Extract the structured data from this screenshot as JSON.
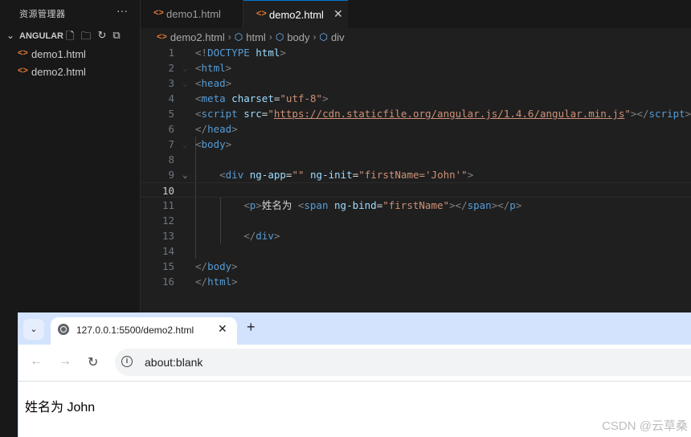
{
  "sidebar": {
    "title": "资源管理器",
    "more": "···",
    "folder": "ANGULAR",
    "files": [
      "demo1.html",
      "demo2.html"
    ]
  },
  "tabs": [
    {
      "label": "demo1.html"
    },
    {
      "label": "demo2.html"
    }
  ],
  "breadcrumb": [
    "demo2.html",
    "html",
    "body",
    "div"
  ],
  "editor": {
    "current_line": 10,
    "line_numbers": [
      "1",
      "2",
      "3",
      "4",
      "5",
      "6",
      "7",
      "8",
      "9",
      "10",
      "11",
      "12",
      "13",
      "14",
      "15",
      "16"
    ],
    "lines": [
      [
        [
          "br",
          "<!"
        ],
        [
          "tag",
          "DOCTYPE"
        ],
        [
          "txt",
          " "
        ],
        [
          "attr",
          "html"
        ],
        [
          "br",
          ">"
        ]
      ],
      [
        [
          "br",
          "<"
        ],
        [
          "tag",
          "html"
        ],
        [
          "br",
          ">"
        ]
      ],
      [
        [
          "br",
          "<"
        ],
        [
          "tag",
          "head"
        ],
        [
          "br",
          ">"
        ]
      ],
      [
        [
          "br",
          "<"
        ],
        [
          "tag",
          "meta"
        ],
        [
          "txt",
          " "
        ],
        [
          "attr",
          "charset"
        ],
        [
          "txt",
          "="
        ],
        [
          "str",
          "\"utf-8\""
        ],
        [
          "br",
          ">"
        ]
      ],
      [
        [
          "br",
          "<"
        ],
        [
          "tag",
          "script"
        ],
        [
          "txt",
          " "
        ],
        [
          "attr",
          "src"
        ],
        [
          "txt",
          "="
        ],
        [
          "str",
          "\""
        ],
        [
          "link",
          "https://cdn.staticfile.org/angular.js/1.4.6/angular.min.js"
        ],
        [
          "str",
          "\""
        ],
        [
          "br",
          "></"
        ],
        [
          "tag",
          "script"
        ],
        [
          "br",
          ">"
        ]
      ],
      [
        [
          "br",
          "</"
        ],
        [
          "tag",
          "head"
        ],
        [
          "br",
          ">"
        ]
      ],
      [
        [
          "br",
          "<"
        ],
        [
          "tag",
          "body"
        ],
        [
          "br",
          ">"
        ]
      ],
      [],
      [
        [
          "txt",
          "    "
        ],
        [
          "br",
          "<"
        ],
        [
          "tag",
          "div"
        ],
        [
          "txt",
          " "
        ],
        [
          "attr",
          "ng-app"
        ],
        [
          "txt",
          "="
        ],
        [
          "str",
          "\"\""
        ],
        [
          "txt",
          " "
        ],
        [
          "attr",
          "ng-init"
        ],
        [
          "txt",
          "="
        ],
        [
          "str",
          "\"firstName='John'\""
        ],
        [
          "br",
          ">"
        ]
      ],
      [],
      [
        [
          "txt",
          "        "
        ],
        [
          "br",
          "<"
        ],
        [
          "tag",
          "p"
        ],
        [
          "br",
          ">"
        ],
        [
          "txt",
          "姓名为 "
        ],
        [
          "br",
          "<"
        ],
        [
          "tag",
          "span"
        ],
        [
          "txt",
          " "
        ],
        [
          "attr",
          "ng-bind"
        ],
        [
          "txt",
          "="
        ],
        [
          "str",
          "\"firstName\""
        ],
        [
          "br",
          "></"
        ],
        [
          "tag",
          "span"
        ],
        [
          "br",
          "></"
        ],
        [
          "tag",
          "p"
        ],
        [
          "br",
          ">"
        ]
      ],
      [],
      [
        [
          "txt",
          "        "
        ],
        [
          "br",
          "</"
        ],
        [
          "tag",
          "div"
        ],
        [
          "br",
          ">"
        ]
      ],
      [],
      [
        [
          "br",
          "</"
        ],
        [
          "tag",
          "body"
        ],
        [
          "br",
          ">"
        ]
      ],
      [
        [
          "br",
          "</"
        ],
        [
          "tag",
          "html"
        ],
        [
          "br",
          ">"
        ]
      ]
    ]
  },
  "browser": {
    "tab_title": "127.0.0.1:5500/demo2.html",
    "address": "about:blank",
    "content": "姓名为 John"
  },
  "watermark": "CSDN @云草桑",
  "colors": {
    "accent": "#0078d4",
    "html_icon": "#e37933"
  }
}
